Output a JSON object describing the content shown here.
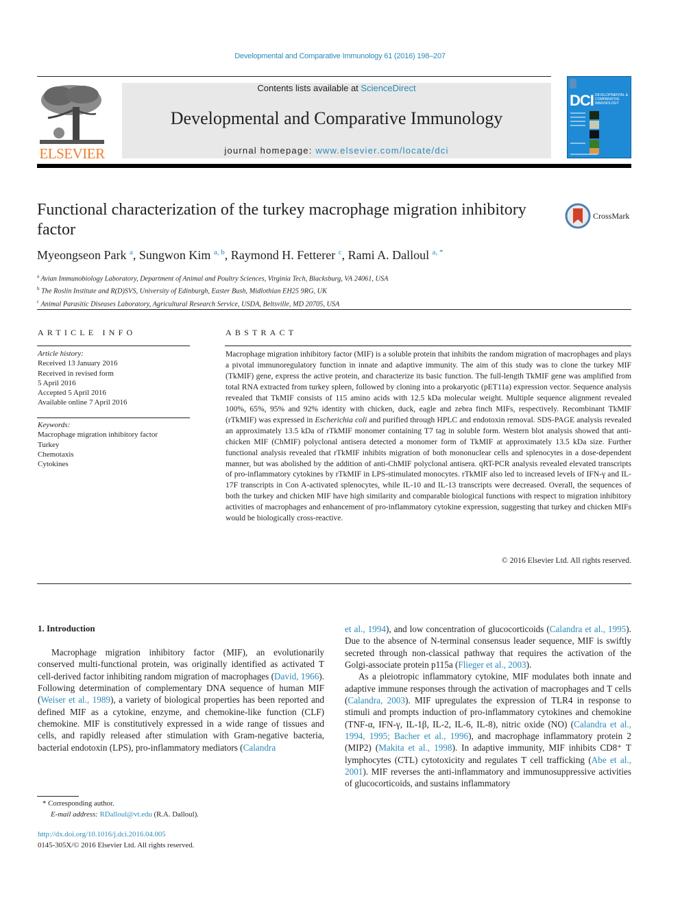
{
  "header": {
    "journal_ref": "Developmental and Comparative Immunology 61 (2016) 198–207",
    "contents_prefix": "Contents lists available at ",
    "contents_link": "ScienceDirect",
    "journal_title": "Developmental and Comparative Immunology",
    "homepage_prefix": "journal homepage: ",
    "homepage_link": "www.elsevier.com/locate/dci",
    "publisher_logo": "ELSEVIER",
    "cover_acronym": "DCI",
    "cover_subtitle": "DEVELOPMENTAL & COMPARATIVE IMMUNOLOGY",
    "brand_color": "#ef7d2d",
    "link_color": "#2a8ab8"
  },
  "article": {
    "title": "Functional characterization of the turkey macrophage migration inhibitory factor",
    "crossmark_label": "CrossMark",
    "authors": [
      {
        "name": "Myeongseon Park",
        "sup": "a"
      },
      {
        "name": "Sungwon Kim",
        "sup": "a, b"
      },
      {
        "name": "Raymond H. Fetterer",
        "sup": "c"
      },
      {
        "name": "Rami A. Dalloul",
        "sup": "a, *"
      }
    ],
    "affiliations": [
      {
        "sup": "a",
        "text": "Avian Immunobiology Laboratory, Department of Animal and Poultry Sciences, Virginia Tech, Blacksburg, VA 24061, USA"
      },
      {
        "sup": "b",
        "text": "The Roslin Institute and R(D)SVS, University of Edinburgh, Easter Bush, Midlothian EH25 9RG, UK"
      },
      {
        "sup": "c",
        "text": "Animal Parasitic Diseases Laboratory, Agricultural Research Service, USDA, Beltsville, MD 20705, USA"
      }
    ]
  },
  "article_info": {
    "heading": "ARTICLE INFO",
    "history_label": "Article history:",
    "history": [
      "Received 13 January 2016",
      "Received in revised form",
      "5 April 2016",
      "Accepted 5 April 2016",
      "Available online 7 April 2016"
    ],
    "keywords_label": "Keywords:",
    "keywords": [
      "Macrophage migration inhibitory factor",
      "Turkey",
      "Chemotaxis",
      "Cytokines"
    ]
  },
  "abstract": {
    "heading": "ABSTRACT",
    "part1": "Macrophage migration inhibitory factor (MIF) is a soluble protein that inhibits the random migration of macrophages and plays a pivotal immunoregulatory function in innate and adaptive immunity. The aim of this study was to clone the turkey MIF (TkMIF) gene, express the active protein, and characterize its basic function. The full-length TkMIF gene was amplified from total RNA extracted from turkey spleen, followed by cloning into a prokaryotic (pET11a) expression vector. Sequence analysis revealed that TkMIF consists of 115 amino acids with 12.5 kDa molecular weight. Multiple sequence alignment revealed 100%, 65%, 95% and 92% identity with chicken, duck, eagle and zebra finch MIFs, respectively. Recombinant TkMIF (rTkMIF) was expressed in ",
    "species": "Escherichia coli",
    "part2": " and purified through HPLC and endotoxin removal. SDS-PAGE analysis revealed an approximately 13.5 kDa of rTkMIF monomer containing T7 tag in soluble form. Western blot analysis showed that anti-chicken MIF (ChMIF) polyclonal antisera detected a monomer form of TkMIF at approximately 13.5 kDa size. Further functional analysis revealed that rTkMIF inhibits migration of both mononuclear cells and splenocytes in a dose-dependent manner, but was abolished by the addition of anti-ChMIF polyclonal antisera. qRT-PCR analysis revealed elevated transcripts of pro-inflammatory cytokines by rTkMIF in LPS-stimulated monocytes. rTkMIF also led to increased levels of IFN-γ and IL-17F transcripts in Con A-activated splenocytes, while IL-10 and IL-13 transcripts were decreased. Overall, the sequences of both the turkey and chicken MIF have high similarity and compa­rable biological functions with respect to migration inhibitory activities of macrophages and enhance­ment of pro-inflammatory cytokine expression, suggesting that turkey and chicken MIFs would be biologically cross-reactive.",
    "copyright": "© 2016 Elsevier Ltd. All rights reserved."
  },
  "intro": {
    "heading": "1.  Introduction",
    "left": [
      {
        "t": "Macrophage migration inhibitory factor (MIF), an evolutionarily conserved multi-functional protein, was originally identified as activated T cell-derived factor inhibiting random migration of macrophages ("
      },
      {
        "l": "David, 1966"
      },
      {
        "t": "). Following determination of comple­mentary DNA sequence of human MIF ("
      },
      {
        "l": "Weiser et al., 1989"
      },
      {
        "t": "), a variety of biological properties has been reported and defined MIF as a cytokine, enzyme, and chemokine-like function (CLF) chemokine. MIF is constitutively expressed in a wide range of tissues and cells, and rapidly released after stimulation with Gram-negative bacteria, bacterial endotoxin (LPS), pro-inflammatory mediators ("
      },
      {
        "l": "Calandra"
      }
    ],
    "right_p1": [
      {
        "l": "et al., 1994"
      },
      {
        "t": "), and low concentration of glucocorticoids ("
      },
      {
        "l": "Calandra et al., 1995"
      },
      {
        "t": "). Due to the absence of N-terminal consensus leader sequence, MIF is swiftly secreted through non-classical pathway that requires the activation of the Golgi-associate protein p115a ("
      },
      {
        "l": "Flieger et al., 2003"
      },
      {
        "t": ")."
      }
    ],
    "right_p2": [
      {
        "t": "As a pleiotropic inflammatory cytokine, MIF modulates both innate and adaptive immune responses through the activation of macrophages and T cells ("
      },
      {
        "l": "Calandra, 2003"
      },
      {
        "t": "). MIF upregulates the expression of TLR4 in response to stimuli and prompts induction of pro-inflammatory cytokines and chemokine (TNF-α, IFN-γ, IL-1β, IL-2, IL-6, IL-8), nitric oxide (NO) ("
      },
      {
        "l": "Calandra et al., 1994, 1995; Bacher et al., 1996"
      },
      {
        "t": "), and macrophage inflammatory protein 2 (MIP2) ("
      },
      {
        "l": "Makita et al., 1998"
      },
      {
        "t": "). In adaptive immunity, MIF inhibits CD8⁺ T lymphocytes (CTL) cytotoxicity and regulates T cell trafficking ("
      },
      {
        "l": "Abe et al., 2001"
      },
      {
        "t": "). MIF reverses the anti-inflammatory and immuno­suppressive activities of glucocorticoids, and sustains inflammatory"
      }
    ]
  },
  "footnote": {
    "corresponding": "* Corresponding author.",
    "email_label": "E-mail address: ",
    "email": "RDalloul@vt.edu",
    "email_suffix": " (R.A. Dalloul).",
    "doi": "http://dx.doi.org/10.1016/j.dci.2016.04.005",
    "issn": "0145-305X/© 2016 Elsevier Ltd. All rights reserved."
  }
}
